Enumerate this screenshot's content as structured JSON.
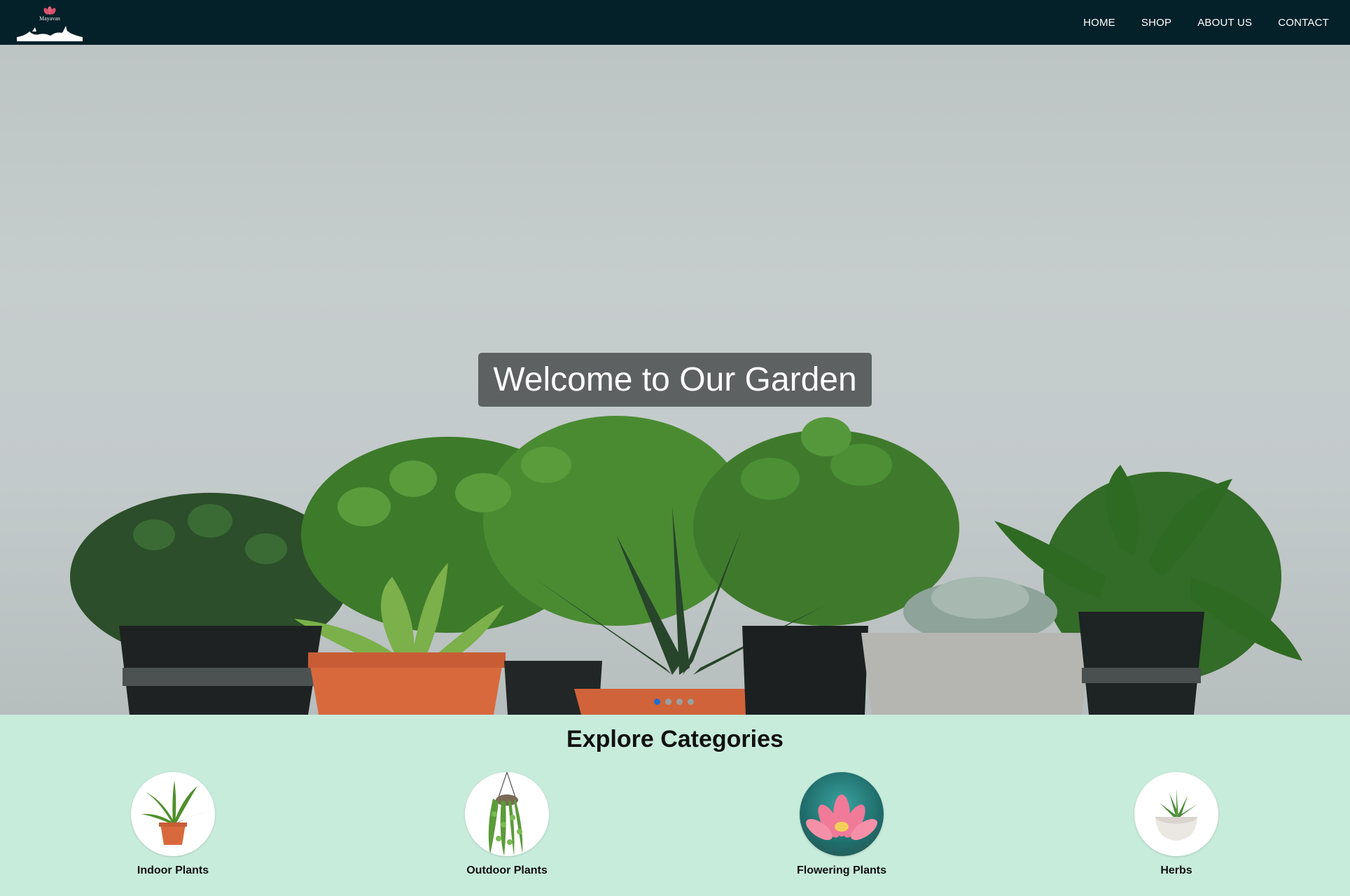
{
  "nav": {
    "logo_text": "Mayavan",
    "links": [
      "HOME",
      "SHOP",
      "ABOUT US",
      "CONTACT"
    ]
  },
  "hero": {
    "title": "Welcome to Our Garden",
    "slides": 4,
    "active_slide": 1
  },
  "categories": {
    "heading": "Explore Categories",
    "items": [
      {
        "label": "Indoor Plants",
        "image": "fern-pot-icon"
      },
      {
        "label": "Outdoor Plants",
        "image": "hanging-plant-icon"
      },
      {
        "label": "Flowering Plants",
        "image": "pink-lotus-icon"
      },
      {
        "label": "Herbs",
        "image": "succulent-bowl-icon"
      }
    ]
  },
  "colors": {
    "navbar": "#04212a",
    "categories_bg": "#c8ecdc",
    "title_box": "#555858",
    "active_dot": "#1f6dcc"
  }
}
